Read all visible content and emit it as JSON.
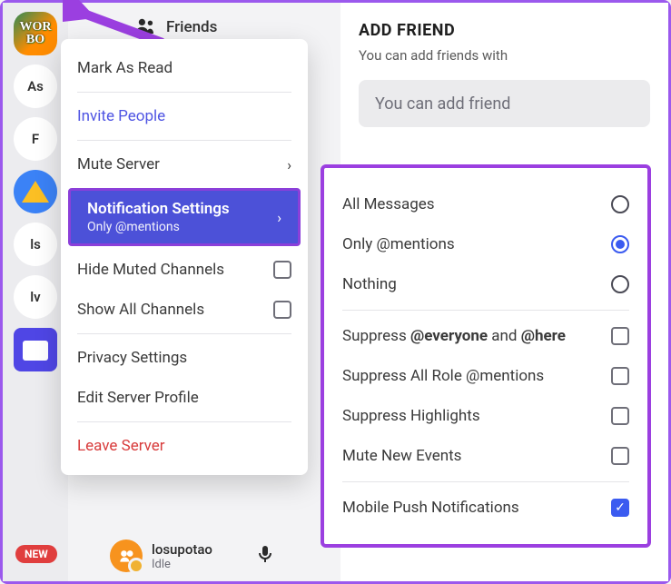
{
  "server_list": {
    "items": [
      "As",
      "F",
      "",
      "ls",
      "lv"
    ],
    "new_badge": "NEW"
  },
  "channel_area": {
    "friends_label": "Friends"
  },
  "main": {
    "add_friend_title": "ADD FRIEND",
    "add_friend_sub": "You can add friends with",
    "add_friend_placeholder": "You can add friend"
  },
  "context_menu": {
    "mark_read": "Mark As Read",
    "invite": "Invite People",
    "mute_server": "Mute Server",
    "notification_settings": {
      "title": "Notification Settings",
      "sub": "Only @mentions"
    },
    "hide_muted": "Hide Muted Channels",
    "show_all": "Show All Channels",
    "privacy": "Privacy Settings",
    "edit_profile": "Edit Server Profile",
    "leave": "Leave Server"
  },
  "submenu": {
    "options": [
      {
        "label": "All Messages",
        "type": "radio",
        "selected": false
      },
      {
        "label": "Only @mentions",
        "type": "radio",
        "selected": true
      },
      {
        "label": "Nothing",
        "type": "radio",
        "selected": false
      }
    ],
    "toggles": [
      {
        "label_html": "Suppress <b>@everyone</b> and <b>@here</b>",
        "label": "Suppress @everyone and @here",
        "checked": false
      },
      {
        "label": "Suppress All Role @mentions",
        "checked": false
      },
      {
        "label": "Suppress Highlights",
        "checked": false
      },
      {
        "label": "Mute New Events",
        "checked": false
      }
    ],
    "push": {
      "label": "Mobile Push Notifications",
      "checked": true
    }
  },
  "user": {
    "name": "losupotao",
    "status": "Idle"
  }
}
